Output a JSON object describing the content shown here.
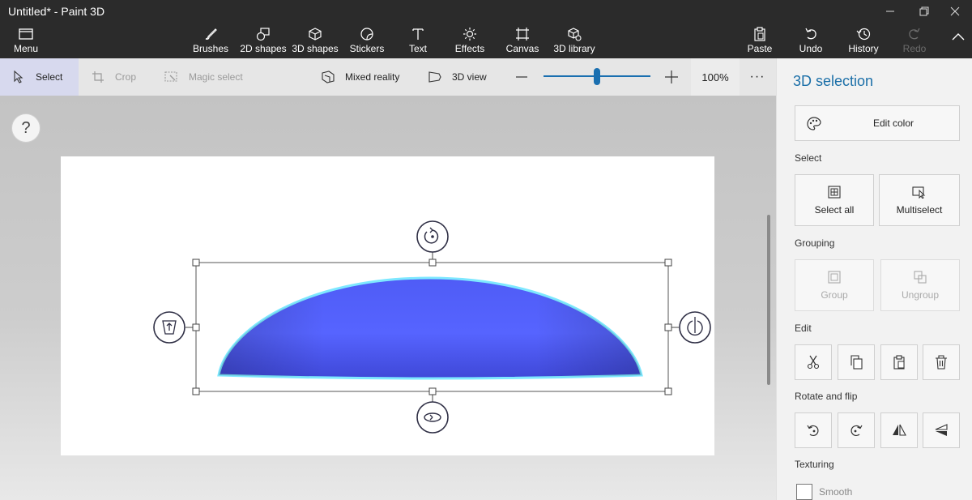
{
  "window": {
    "title": "Untitled* - Paint 3D"
  },
  "ribbon": {
    "menu": "Menu",
    "tools": [
      "Brushes",
      "2D shapes",
      "3D shapes",
      "Stickers",
      "Text",
      "Effects",
      "Canvas",
      "3D library"
    ],
    "paste": "Paste",
    "undo": "Undo",
    "history": "History",
    "redo": "Redo"
  },
  "subbar": {
    "select": "Select",
    "crop": "Crop",
    "magic_select": "Magic select",
    "mixed_reality": "Mixed reality",
    "view_3d": "3D view",
    "zoom": "100%",
    "zoom_level": 0.5,
    "more": "···"
  },
  "help": {
    "label": "?"
  },
  "panel": {
    "title": "3D selection",
    "edit_color": "Edit color",
    "select_heading": "Select",
    "select_all": "Select all",
    "multiselect": "Multiselect",
    "grouping_heading": "Grouping",
    "group": "Group",
    "ungroup": "Ungroup",
    "edit_heading": "Edit",
    "rotate_heading": "Rotate and flip",
    "texturing_heading": "Texturing",
    "smooth": "Smooth",
    "smooth_checked": false
  },
  "colors": {
    "shape_fill": "#4f5cf6",
    "shape_outline": "#7ee8ff",
    "accent": "#1b6fa8",
    "slider": "#1a6fb0"
  }
}
